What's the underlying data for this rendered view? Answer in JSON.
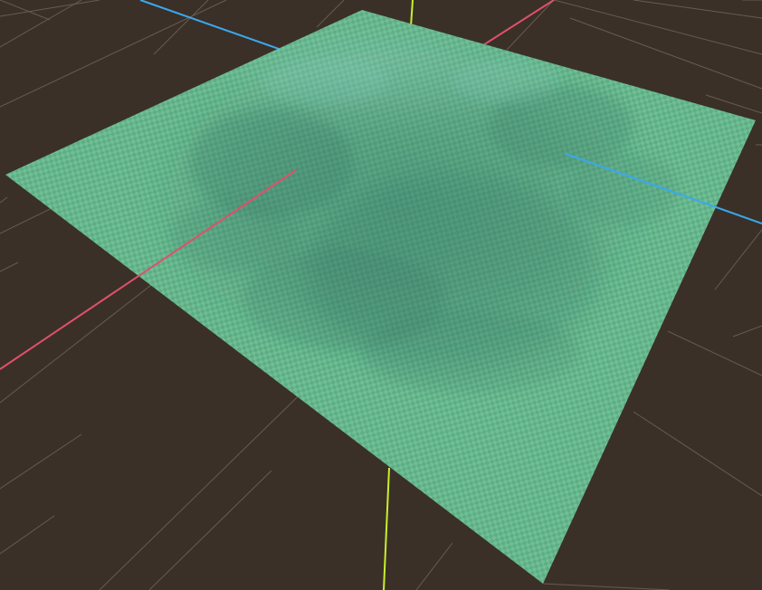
{
  "viewport": {
    "background_color": "#3a3027",
    "grid_line_color": "#6e6459",
    "show_grid": true,
    "show_axes": true
  },
  "axes": {
    "x": {
      "name": "x-axis",
      "color": "#e0506a"
    },
    "y": {
      "name": "y-axis",
      "color": "#c8ef2e"
    },
    "z": {
      "name": "z-axis",
      "color": "#3aa8f0"
    }
  },
  "terrain": {
    "object_name": "terrain-mesh",
    "base_color": "#5fad85",
    "checker_color": "#6fbf95",
    "shade_color": "#3f7a6a",
    "material": "checker-debug"
  }
}
